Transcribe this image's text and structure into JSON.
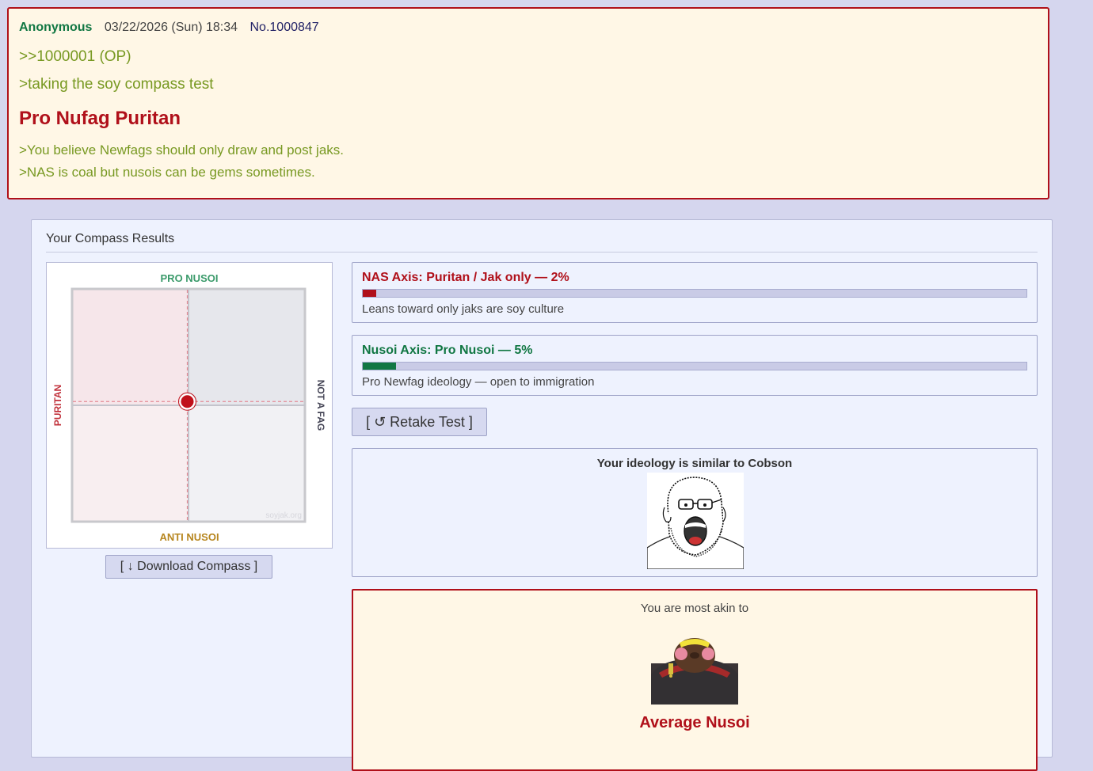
{
  "post": {
    "name": "Anonymous",
    "date": "03/22/2026 (Sun) 18:34",
    "number": "No.1000847",
    "reply_ref": ">>1000001 (OP)",
    "greentext_1": ">taking the soy compass test",
    "verdict": "Pro Nufag Puritan",
    "greentext_2": ">You believe Newfags should only draw and post jaks.",
    "greentext_3": ">NAS is coal but nusois can be gems sometimes."
  },
  "results": {
    "title": "Your Compass Results",
    "compass": {
      "label_top": "PRO NUSOI",
      "label_bottom": "ANTI NUSOI",
      "label_left": "PURITAN",
      "label_right": "NOT A FAG",
      "watermark": "soyjak.org",
      "marker_x_fraction": 0.02,
      "marker_y_fraction": 0.47
    },
    "download_label": "[ ↓ Download Compass ]",
    "axes": [
      {
        "title": "NAS Axis: Puritan / Jak only — 2%",
        "percent": 2,
        "color": "#b0101a",
        "description": "Leans toward only jaks are soy culture"
      },
      {
        "title": "Nusoi Axis: Pro Nusoi — 5%",
        "percent": 5,
        "color": "#117743",
        "description": "Pro Newfag ideology — open to immigration"
      }
    ],
    "retake_label": "[ ↺ Retake Test ]",
    "similar_label": "Your ideology is similar to Cobson",
    "akin_label": "You are most akin to",
    "akin_name": "Average Nusoi"
  },
  "colors": {
    "background": "#d5d6ee",
    "post_bg": "#fff7e6",
    "accent_red": "#b0101a",
    "greentext": "#789922",
    "name_green": "#117743"
  }
}
